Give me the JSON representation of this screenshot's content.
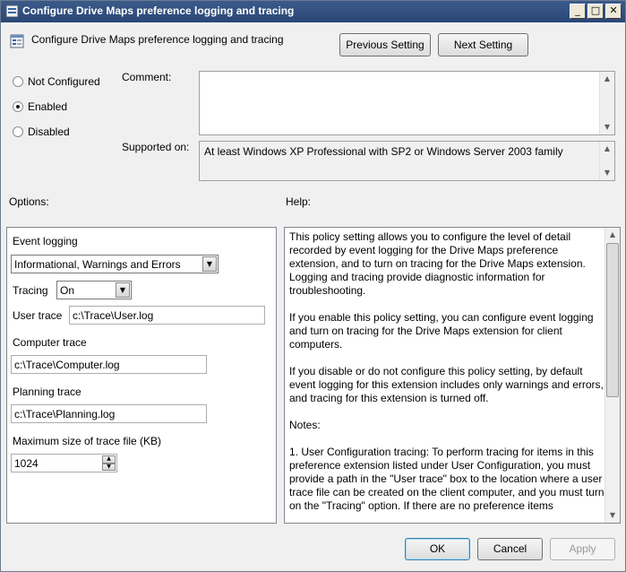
{
  "window": {
    "title": "Configure Drive Maps preference logging and tracing",
    "buttons": {
      "minimize": "_",
      "maximize": "□",
      "close": "✕"
    }
  },
  "header": {
    "title": "Configure Drive Maps preference logging and tracing",
    "prev_label": "Previous Setting",
    "next_label": "Next Setting"
  },
  "state": {
    "options": [
      {
        "label": "Not Configured",
        "checked": false
      },
      {
        "label": "Enabled",
        "checked": true
      },
      {
        "label": "Disabled",
        "checked": false
      }
    ]
  },
  "comment": {
    "label": "Comment:",
    "value": ""
  },
  "supported": {
    "label": "Supported on:",
    "value": "At least Windows XP Professional with SP2 or Windows Server 2003 family"
  },
  "options_section": {
    "heading": "Options:",
    "event_logging_label": "Event logging",
    "event_logging_value": "Informational, Warnings and Errors",
    "tracing_label": "Tracing",
    "tracing_value": "On",
    "user_trace_label": "User trace",
    "user_trace_value": "c:\\Trace\\User.log",
    "computer_trace_label": "Computer trace",
    "computer_trace_value": "c:\\Trace\\Computer.log",
    "planning_trace_label": "Planning trace",
    "planning_trace_value": "c:\\Trace\\Planning.log",
    "max_size_label": "Maximum size of trace file (KB)",
    "max_size_value": "1024"
  },
  "help_section": {
    "heading": "Help:",
    "paragraphs": [
      "This policy setting allows you to configure the level of detail recorded by event logging for the Drive Maps preference extension, and to turn on tracing for the Drive Maps extension. Logging and tracing provide diagnostic information for troubleshooting.",
      "If you enable this policy setting, you can configure event logging and turn on tracing for the Drive Maps extension for client computers.",
      "If you disable or do not configure this policy setting, by default event logging for this extension includes only warnings and errors, and tracing for this extension is turned off.",
      "Notes:",
      "1. User Configuration tracing: To perform tracing for items in this preference extension listed under User Configuration, you must provide a path in the \"User trace\" box to the location where a user trace file can be created on the client computer, and you must turn on the \"Tracing\" option. If there are no preference items"
    ]
  },
  "footer": {
    "ok_label": "OK",
    "cancel_label": "Cancel",
    "apply_label": "Apply"
  },
  "icons": {
    "scroll_up": "▲",
    "scroll_down": "▼",
    "dropdown": "▼",
    "spin_up": "▲",
    "spin_down": "▼"
  }
}
